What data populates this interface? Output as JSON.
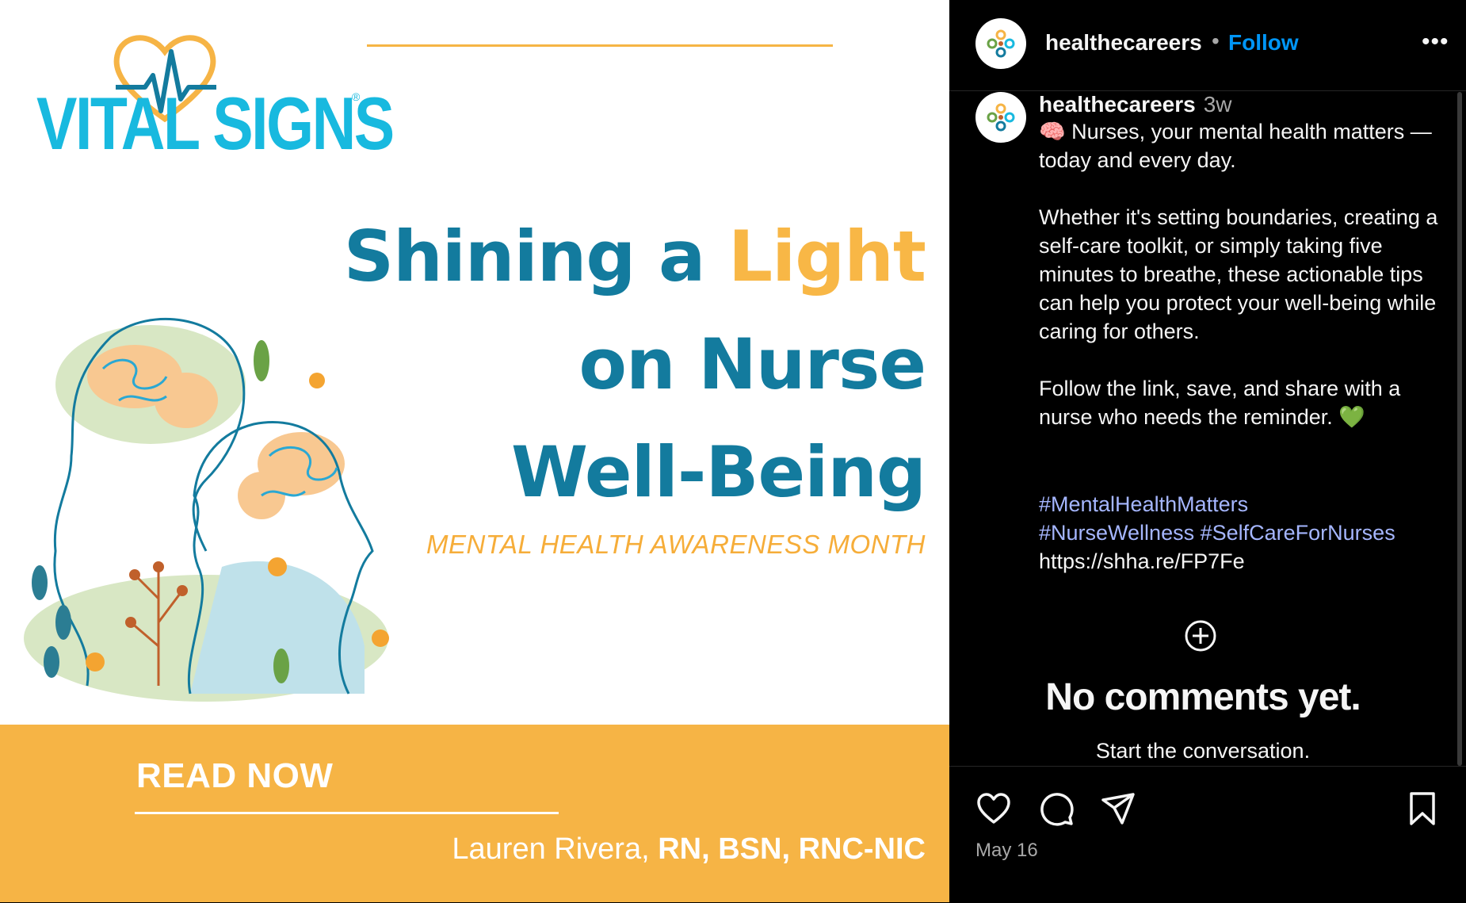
{
  "post_image": {
    "logo_text": "VITAL SIGNS",
    "logo_registered": "®",
    "headline": {
      "line1_a": "Shining a ",
      "line1_b": "Light",
      "line2": "on Nurse",
      "line3": "Well-Being"
    },
    "subtitle": "MENTAL HEALTH AWARENESS MONTH",
    "read_now": "READ NOW",
    "author_name": "Lauren Rivera, ",
    "author_credentials": "RN, BSN, RNC-NIC"
  },
  "header": {
    "username": "healthecareers",
    "separator": "•",
    "follow_label": "Follow",
    "more_label": "•••"
  },
  "caption": {
    "username": "healthecareers",
    "time_ago": "3w",
    "text": "🧠 Nurses, your mental health matters —today and every day.\n\nWhether it's setting boundaries, creating a self-care toolkit, or simply taking five minutes to breathe, these actionable tips can help you protect your well-being while caring for others.\n\nFollow the link, save, and share with a nurse who needs the reminder. 💚",
    "hashtags": [
      "#MentalHealthMatters",
      "#NurseWellness",
      "#SelfCareForNurses"
    ],
    "link": "https://shha.re/FP7Fe"
  },
  "comments": {
    "empty_title": "No comments yet.",
    "empty_subtitle": "Start the conversation."
  },
  "actions": {
    "icons": [
      "heart-icon",
      "comment-icon",
      "share-icon",
      "bookmark-icon"
    ],
    "date": "May 16"
  },
  "colors": {
    "brand_teal": "#137b9e",
    "brand_orange": "#f6b445",
    "logo_blue": "#18b9df",
    "follow_blue": "#0095f6",
    "hashtag": "#a5b6ff"
  }
}
